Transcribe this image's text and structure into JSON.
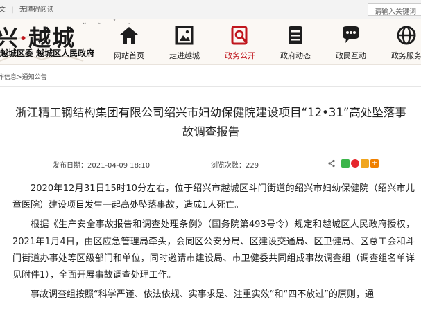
{
  "topbar": {
    "lang_label": "文",
    "accessible_label": "无障碍阅读",
    "search_placeholder": "请输入关键词"
  },
  "header": {
    "brand_part1": "兴",
    "brand_dot": "·",
    "brand_part2": "越城",
    "subtitle": "越城区委  越城区人民政府",
    "nav": [
      {
        "label": "网站首页",
        "icon": "home-icon"
      },
      {
        "label": "走进越城",
        "icon": "picture-icon"
      },
      {
        "label": "政务公开",
        "icon": "search-doc-icon",
        "active": true
      },
      {
        "label": "政府动态",
        "icon": "document-icon"
      },
      {
        "label": "政民互动",
        "icon": "chat-icon"
      },
      {
        "label": "政务服务",
        "icon": "globe-icon"
      }
    ]
  },
  "breadcrumb": {
    "items": [
      "作信息",
      "通知公告"
    ],
    "separator": ">"
  },
  "article": {
    "title": "浙江精工钢结构集团有限公司绍兴市妇幼保健院建设项目“12•31”高处坠落事故调查报告",
    "publish_label": "发布日期：",
    "publish_value": "2021-04-09 18:10",
    "views_label": "浏览次数：",
    "views_value": "229",
    "share_icons": [
      "share-icon",
      "wechat-icon",
      "weibo-icon",
      "qzone-icon",
      "plus-icon"
    ],
    "paragraphs": [
      "2020年12月31日15时10分左右，位于绍兴市越城区斗门街道的绍兴市妇幼保健院（绍兴市儿童医院）建设项目发生一起高处坠落事故，造成1人死亡。",
      "根据《生产安全事故报告和调查处理条例》（国务院第493号令）规定和越城区人民政府授权，2021年1月4日，由区应急管理局牵头，会同区公安分局、区建设交通局、区卫健局、区总工会和斗门街道办事处等区级部门和单位，同时邀请市建设局、市卫健委共同组成事故调查组（调查组名单详见附件1），全面开展事故调查处理工作。",
      "事故调查组按照“科学严谨、依法依规、实事求是、注重实效”和“四不放过”的原则，通"
    ]
  },
  "colors": {
    "accent": "#c0161d",
    "header_bg": "#fbf8f4",
    "topbar_bg": "#f3f3f3"
  }
}
